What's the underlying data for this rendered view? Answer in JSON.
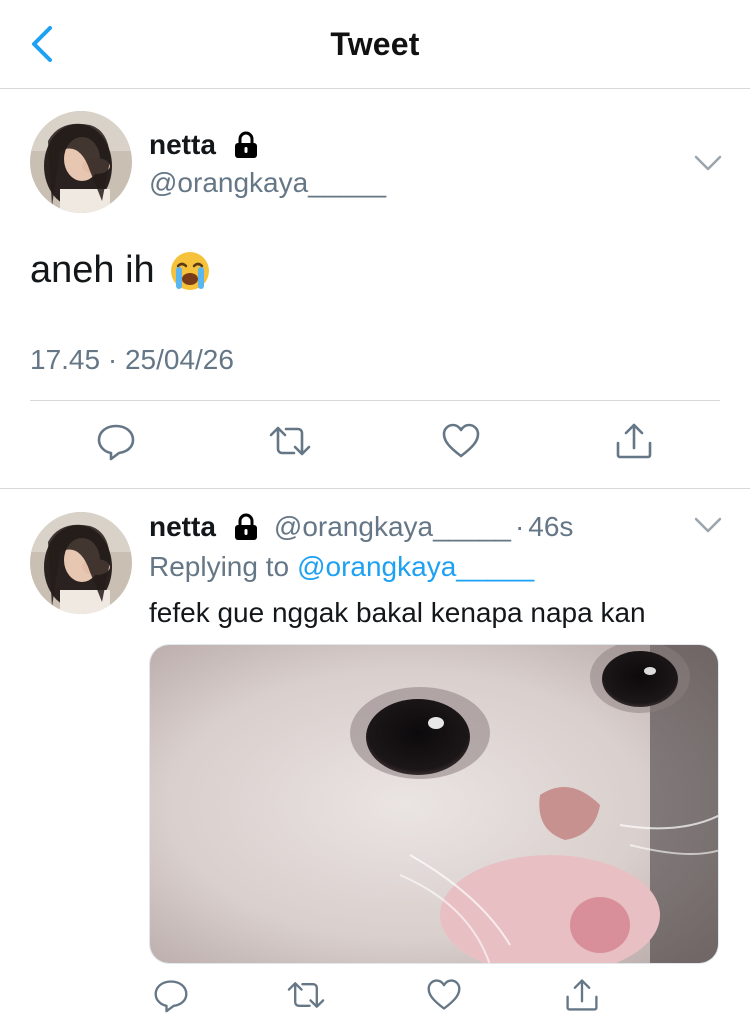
{
  "header": {
    "title": "Tweet",
    "back_icon": "chevron-left-icon",
    "accent_color": "#1da1f2"
  },
  "main_tweet": {
    "display_name": "netta",
    "protected_icon": "lock-icon",
    "handle": "@orangkaya_____",
    "text": "aneh ih",
    "emoji": "loudly-crying-face-emoji",
    "timestamp": "17.45 · 25/04/26",
    "actions": [
      "reply-icon",
      "retweet-icon",
      "like-icon",
      "share-icon"
    ]
  },
  "reply": {
    "display_name": "netta",
    "handle": "@orangkaya_____",
    "separator": "·",
    "time": "46s",
    "replying_prefix": "Replying to",
    "replying_to": "@orangkaya_____",
    "text": "fefek gue nggak bakal kenapa napa kan",
    "media": "crying-cat-photo",
    "actions": [
      "reply-icon",
      "retweet-icon",
      "like-icon",
      "share-icon"
    ]
  },
  "colors": {
    "text_primary": "#14171a",
    "text_secondary": "#657786",
    "link": "#1da1f2",
    "divider": "#d6d9dc"
  }
}
